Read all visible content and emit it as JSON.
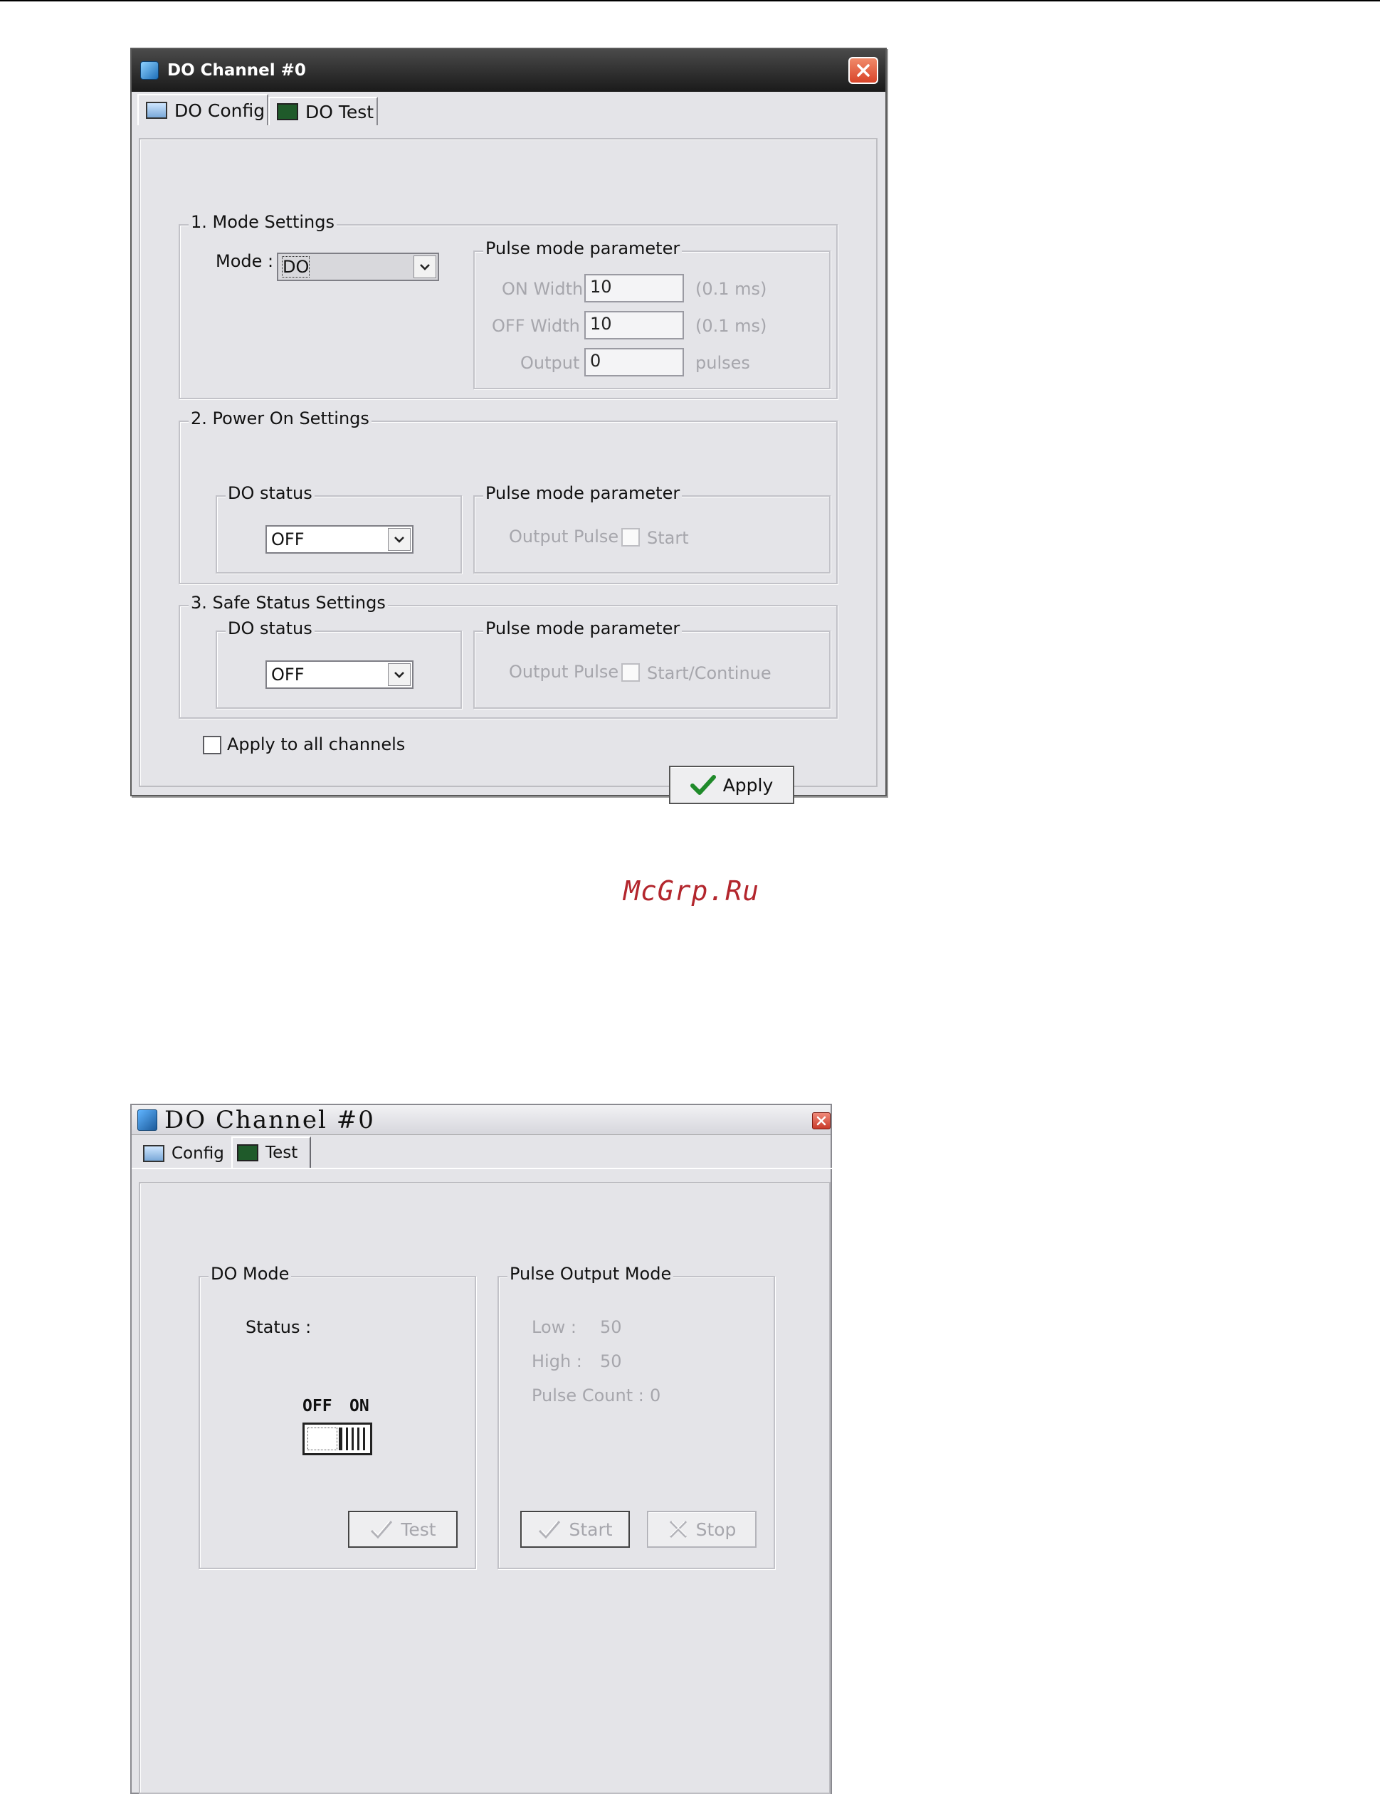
{
  "watermark": "McGrp.Ru",
  "window1": {
    "title": "DO Channel #0",
    "tabs": [
      "DO Config",
      "DO Test"
    ],
    "mode_settings": {
      "label": "1. Mode Settings",
      "mode_label": "Mode :",
      "mode_value": "DO",
      "pulse": {
        "label": "Pulse mode parameter",
        "on_width_label": "ON Width :",
        "on_width_value": "10",
        "on_width_unit": "(0.1 ms)",
        "off_width_label": "OFF Width :",
        "off_width_value": "10",
        "off_width_unit": "(0.1 ms)",
        "output_label": "Output :",
        "output_value": "0",
        "output_unit": "pulses"
      }
    },
    "power_on": {
      "label": "2. Power On Settings",
      "do_status_label": "DO status",
      "do_status_value": "OFF",
      "pulse_label": "Pulse mode parameter",
      "output_pulse_label": "Output Pulse :",
      "start_label": "Start"
    },
    "safe_status": {
      "label": "3. Safe Status Settings",
      "do_status_label": "DO status",
      "do_status_value": "OFF",
      "pulse_label": "Pulse mode parameter",
      "output_pulse_label": "Output Pulse :",
      "start_continue_label": "Start/Continue"
    },
    "apply_all_label": "Apply to all channels",
    "apply_button": "Apply"
  },
  "window2": {
    "title": "DO Channel #0",
    "tabs": [
      "Config",
      "Test"
    ],
    "do_mode": {
      "label": "DO Mode",
      "status_label": "Status :",
      "off_label": "OFF",
      "on_label": "ON",
      "test_button": "Test"
    },
    "pulse_output": {
      "label": "Pulse Output Mode",
      "low_label": "Low :",
      "low_value": "50",
      "high_label": "High :",
      "high_value": "50",
      "pulse_count_label": "Pulse Count :",
      "pulse_count_value": "0",
      "start_button": "Start",
      "stop_button": "Stop"
    }
  }
}
